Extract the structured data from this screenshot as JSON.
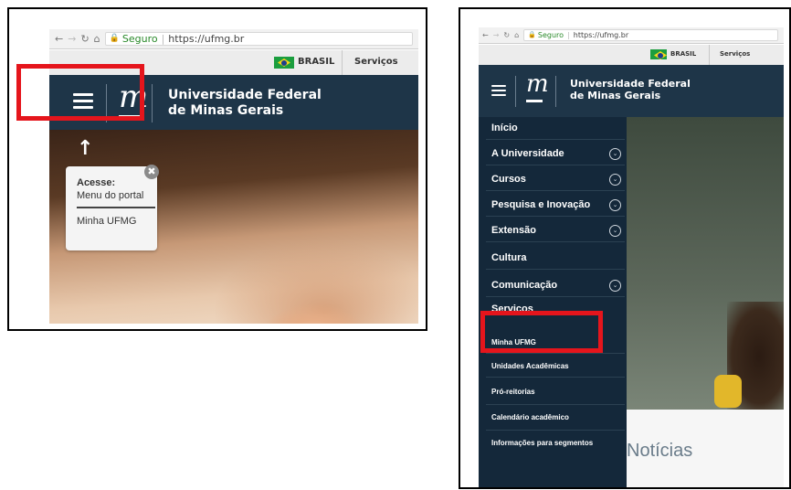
{
  "browser": {
    "nav_icons": [
      "back-arrow-icon",
      "forward-arrow-icon",
      "reload-icon",
      "home-icon"
    ],
    "secure_label": "Seguro",
    "url": "https://ufmg.br"
  },
  "govbar": {
    "country_label": "BRASIL",
    "services_label": "Serviços"
  },
  "header": {
    "logo_letter": "m",
    "name_line1": "Universidade Federal",
    "name_line2": "de Minas Gerais"
  },
  "popup": {
    "title": "Acesse:",
    "menu_label": "Menu do portal",
    "minha_label": "Minha UFMG",
    "close_label": "✖"
  },
  "sidemenu": {
    "items": [
      {
        "label": "Início"
      },
      {
        "label": "A Universidade"
      },
      {
        "label": "Cursos"
      },
      {
        "label": "Pesquisa e Inovação"
      },
      {
        "label": "Extensão"
      },
      {
        "label": "Cultura"
      },
      {
        "label": "Comunicação"
      },
      {
        "label": "Serviços"
      }
    ],
    "sub_items": [
      {
        "label": "Minha UFMG"
      },
      {
        "label": "Unidades Acadêmicas"
      },
      {
        "label": "Pró-reitorias"
      },
      {
        "label": "Calendário acadêmico"
      },
      {
        "label": "Informações para segmentos"
      }
    ]
  },
  "main": {
    "noticias_label": "Notícias"
  },
  "colors": {
    "header_bg": "#1e3548",
    "menu_bg": "#14283a",
    "highlight_red": "#e5151c"
  }
}
